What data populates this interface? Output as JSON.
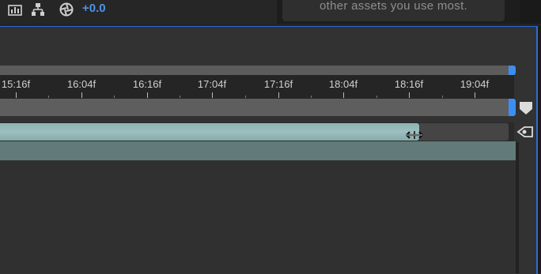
{
  "toolbar": {
    "offset_value": "+0.0",
    "icons": [
      "graph-icon",
      "hierarchy-icon",
      "motion-blur-icon"
    ]
  },
  "hint_panel": {
    "text": "other assets you use most."
  },
  "ruler": {
    "ticks": [
      {
        "label": "15:16f"
      },
      {
        "label": "16:04f"
      },
      {
        "label": "16:16f"
      },
      {
        "label": "17:04f"
      },
      {
        "label": "17:16f"
      },
      {
        "label": "18:04f"
      },
      {
        "label": "18:16f"
      },
      {
        "label": "19:04f"
      }
    ]
  },
  "colors": {
    "accent": "#3d8ef2",
    "layer_bar": "#9cc0c0",
    "offset_text": "#4d93e8"
  }
}
